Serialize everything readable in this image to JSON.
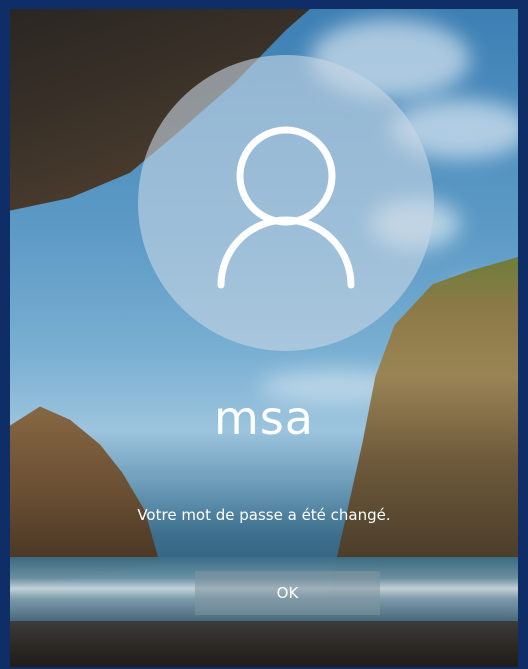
{
  "login": {
    "username": "msa",
    "message": "Votre mot de passe a été changé.",
    "ok_label": "OK",
    "avatar_icon": "user-icon"
  },
  "colors": {
    "frame_border": "#0f2d66",
    "text": "#ffffff"
  }
}
